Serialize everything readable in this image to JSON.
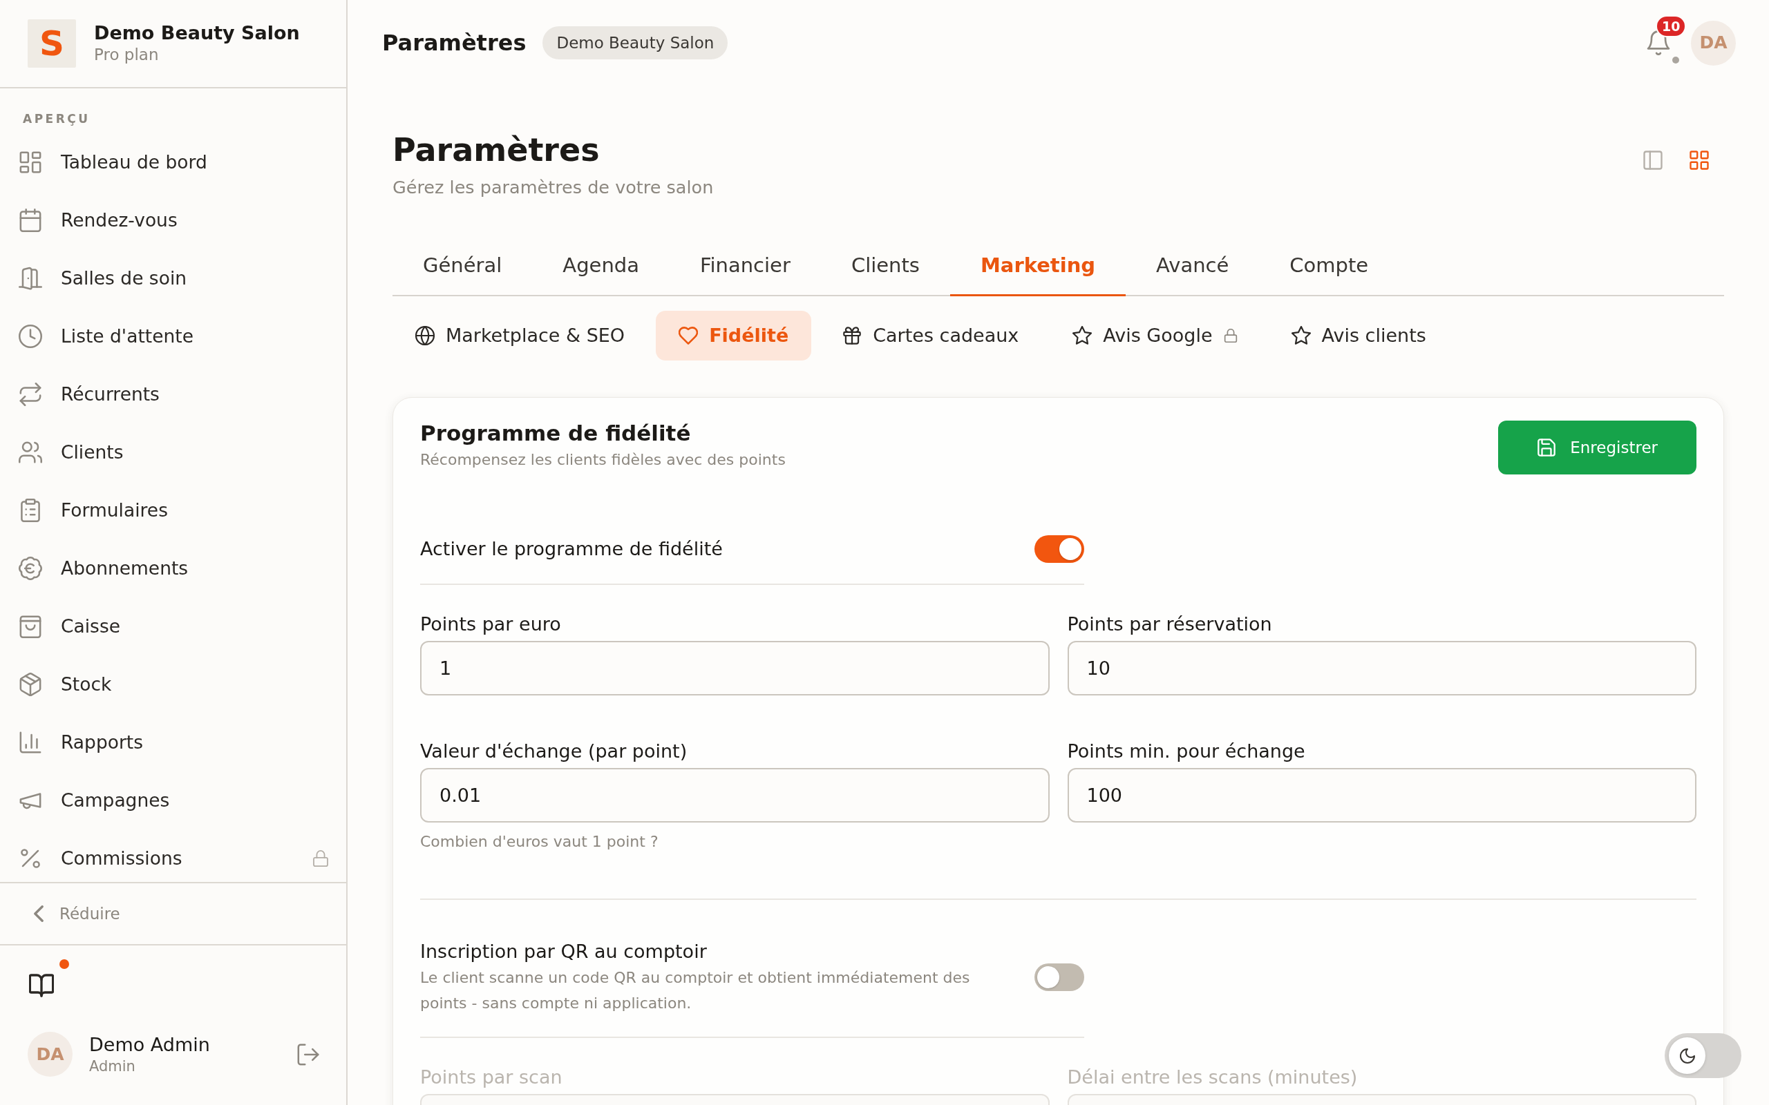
{
  "sidebar": {
    "brand": {
      "logo": "S",
      "name": "Demo Beauty Salon",
      "plan": "Pro plan"
    },
    "section": "APERÇU",
    "items": [
      {
        "label": "Tableau de bord",
        "selected": false,
        "locked": false
      },
      {
        "label": "Rendez-vous",
        "selected": false,
        "locked": false
      },
      {
        "label": "Salles de soin",
        "selected": false,
        "locked": false
      },
      {
        "label": "Liste d'attente",
        "selected": false,
        "locked": false
      },
      {
        "label": "Récurrents",
        "selected": false,
        "locked": false
      },
      {
        "label": "Clients",
        "selected": false,
        "locked": false
      },
      {
        "label": "Formulaires",
        "selected": false,
        "locked": false
      },
      {
        "label": "Abonnements",
        "selected": false,
        "locked": false
      },
      {
        "label": "Caisse",
        "selected": false,
        "locked": false
      },
      {
        "label": "Stock",
        "selected": false,
        "locked": false
      },
      {
        "label": "Rapports",
        "selected": false,
        "locked": false
      },
      {
        "label": "Campagnes",
        "selected": false,
        "locked": false
      },
      {
        "label": "Commissions",
        "selected": false,
        "locked": true
      }
    ],
    "collapse": "Réduire",
    "docs": {
      "unread": true
    },
    "user": {
      "initials": "DA",
      "name": "Demo Admin",
      "role": "Admin"
    }
  },
  "topbar": {
    "title": "Paramètres",
    "badge": "Demo Beauty Salon",
    "notifications": "10",
    "avatar": "DA"
  },
  "page": {
    "title": "Paramètres",
    "subtitle": "Gérez les paramètres de votre salon",
    "views": [
      {
        "selected": false
      },
      {
        "selected": true
      }
    ]
  },
  "tabs": [
    {
      "label": "Général",
      "selected": false
    },
    {
      "label": "Agenda",
      "selected": false
    },
    {
      "label": "Financier",
      "selected": false
    },
    {
      "label": "Clients",
      "selected": false
    },
    {
      "label": "Marketing",
      "selected": true
    },
    {
      "label": "Avancé",
      "selected": false
    },
    {
      "label": "Compte",
      "selected": false
    }
  ],
  "subtabs": [
    {
      "label": "Marketplace & SEO",
      "selected": false,
      "locked": false
    },
    {
      "label": "Fidélité",
      "selected": true,
      "locked": false
    },
    {
      "label": "Cartes cadeaux",
      "selected": false,
      "locked": false
    },
    {
      "label": "Avis Google",
      "selected": false,
      "locked": true
    },
    {
      "label": "Avis clients",
      "selected": false,
      "locked": false
    }
  ],
  "card": {
    "title": "Programme de fidélité",
    "subtitle": "Récompensez les clients fidèles avec des points",
    "save_button": "Enregistrer",
    "groups": [
      {
        "toggle": {
          "label": "Activer le programme de fidélité",
          "on": true
        },
        "fields": [
          {
            "label": "Points par euro",
            "value": "1",
            "disabled": false
          },
          {
            "label": "Points par réservation",
            "value": "10",
            "disabled": false
          },
          {
            "label": "Valeur d'échange (par point)",
            "value": "0.01",
            "help": "Combien d'euros vaut 1 point ?",
            "disabled": false
          },
          {
            "label": "Points min. pour échange",
            "value": "100",
            "disabled": false
          }
        ]
      },
      {
        "toggle": {
          "label": "Inscription par QR au comptoir",
          "description": "Le client scanne un code QR au comptoir et obtient immédiatement des points - sans compte ni application.",
          "on": false
        },
        "fields": [
          {
            "label": "Points par scan",
            "disabled": true
          },
          {
            "label": "Délai entre les scans (minutes)",
            "disabled": true
          }
        ]
      }
    ]
  },
  "theme_switch": {
    "on": false
  }
}
